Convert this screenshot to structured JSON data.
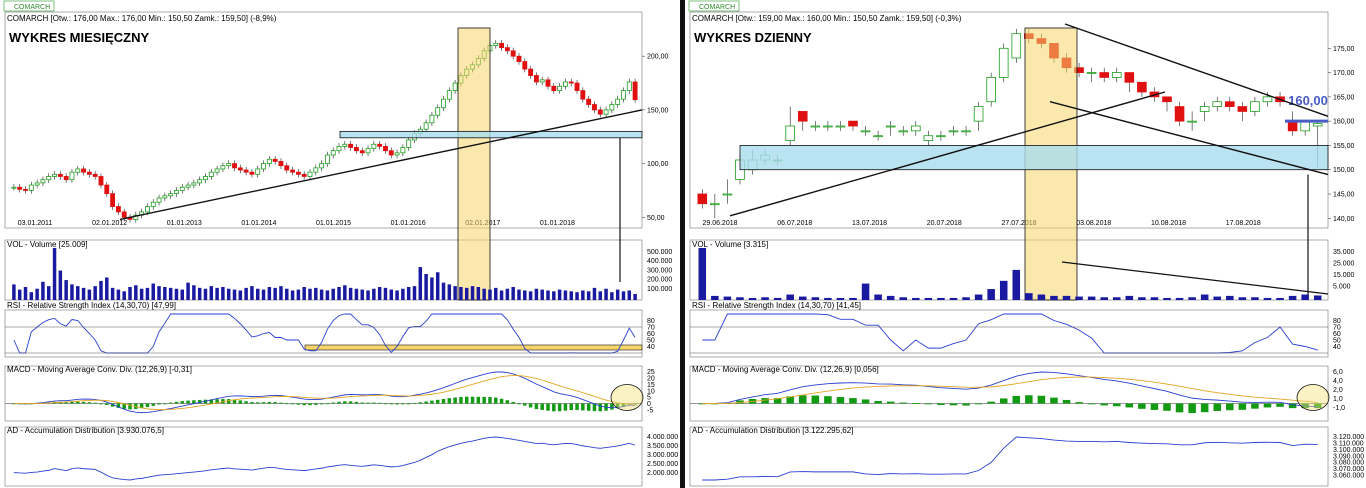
{
  "panels": [
    {
      "tab": "COMARCH",
      "info": "COMARCH [Otw.: 176,00  Max.: 176,00  Min.: 150,50  Zamk.: 159,50] (-8,9%)",
      "big_title": "WYKRES MIESIĘCZNY",
      "vol_title": "VOL - Volume [25.009]",
      "rsi_title": "RSI - Relative Strength Index (14,30,70) [47,99]",
      "macd_title": "MACD - Moving Average Conv. Div. (12,26,9) [-0,31]",
      "ad_title": "AD - Accumulation Distribution [3.930.076,5]",
      "price_labels": [
        "200,00",
        "150,00",
        "100,00",
        "50,00"
      ],
      "date_labels": [
        "03.01.2011",
        "02.01.2012",
        "01.01.2013",
        "01.01.2014",
        "01.01.2015",
        "01.01.2016",
        "02.01.2017",
        "01.01.2018"
      ],
      "vol_labels": [
        "500.000",
        "400.000",
        "300.000",
        "200.000",
        "100.000"
      ],
      "rsi_labels": [
        "80",
        "70",
        "60",
        "50",
        "40"
      ],
      "macd_labels": [
        "25",
        "20",
        "15",
        "10",
        "5",
        "0",
        "-5"
      ],
      "ad_labels": [
        "4.000.000",
        "3.500.000",
        "3.000.000",
        "2.500.000",
        "2.000.000"
      ]
    },
    {
      "tab": "COMARCH",
      "info": "COMARCH [Otw.: 159,00  Max.: 160,00  Min.: 150,50  Zamk.: 159,50] (-0,3%)",
      "big_title": "WYKRES DZIENNY",
      "price_tag": "160,00",
      "vol_title": "VOL - Volume [3.315]",
      "rsi_title": "RSI - Relative Strength Index (14,30,70) [41,45]",
      "macd_title": "MACD - Moving Average Conv. Div. (12,26,9) [0,056]",
      "ad_title": "AD - Accumulation Distribution [3.122.295,62]",
      "price_labels": [
        "175,00",
        "170,00",
        "165,00",
        "160,00",
        "155,00",
        "150,00",
        "145,00",
        "140,00"
      ],
      "date_labels": [
        "29.06.2018",
        "06.07.2018",
        "13.07.2018",
        "20.07.2018",
        "27.07.2018",
        "03.08.2018",
        "10.08.2018",
        "17.08.2018"
      ],
      "vol_labels": [
        "35.000",
        "25.000",
        "15.000",
        "5.000"
      ],
      "rsi_labels": [
        "80",
        "70",
        "60",
        "50",
        "40"
      ],
      "macd_labels": [
        "6,0",
        "4,0",
        "2,0",
        "1,0",
        "-1,0"
      ],
      "ad_labels": [
        "3.120.000",
        "3.110.000",
        "3.100.000",
        "3.090.000",
        "3.080.000",
        "3.070.000",
        "3.060.000"
      ]
    }
  ],
  "chart_data": [
    {
      "type": "candlestick",
      "title": "WYKRES MIESIĘCZNY",
      "frequency": "monthly",
      "x_start": "2010-09",
      "close": [
        78,
        76,
        75,
        80,
        82,
        85,
        88,
        90,
        88,
        85,
        92,
        95,
        92,
        90,
        88,
        80,
        72,
        60,
        55,
        50,
        48,
        52,
        55,
        60,
        64,
        68,
        70,
        72,
        75,
        78,
        80,
        82,
        85,
        88,
        92,
        95,
        98,
        100,
        96,
        94,
        92,
        90,
        95,
        100,
        104,
        102,
        98,
        94,
        92,
        90,
        88,
        92,
        96,
        100,
        108,
        112,
        116,
        118,
        115,
        112,
        110,
        114,
        118,
        116,
        112,
        108,
        110,
        115,
        122,
        128,
        132,
        138,
        145,
        152,
        160,
        168,
        175,
        182,
        188,
        192,
        198,
        205,
        210,
        212,
        208,
        205,
        200,
        195,
        188,
        182,
        176,
        178,
        172,
        168,
        172,
        176,
        175,
        168,
        160,
        155,
        150,
        146,
        150,
        155,
        160,
        168,
        176,
        159.5
      ],
      "vol_title": "VOL - Volume [25.009]",
      "volume": [
        180000,
        120000,
        150000,
        90000,
        130000,
        210000,
        160000,
        600000,
        340000,
        230000,
        180000,
        160000,
        140000,
        120000,
        160000,
        220000,
        260000,
        140000,
        120000,
        100000,
        150000,
        170000,
        130000,
        140000,
        190000,
        160000,
        150000,
        140000,
        130000,
        120000,
        200000,
        170000,
        140000,
        130000,
        160000,
        140000,
        150000,
        130000,
        120000,
        110000,
        140000,
        160000,
        130000,
        120000,
        150000,
        140000,
        160000,
        130000,
        110000,
        120000,
        150000,
        130000,
        140000,
        120000,
        110000,
        130000,
        150000,
        170000,
        140000,
        130000,
        120000,
        110000,
        130000,
        150000,
        140000,
        120000,
        110000,
        130000,
        150000,
        160000,
        380000,
        300000,
        260000,
        320000,
        200000,
        180000,
        160000,
        150000,
        140000,
        160000,
        150000,
        130000,
        120000,
        140000,
        110000,
        130000,
        150000,
        120000,
        110000,
        100000,
        130000,
        120000,
        110000,
        100000,
        120000,
        110000,
        100000,
        90000,
        110000,
        100000,
        140000,
        100000,
        130000,
        90000,
        120000,
        100000,
        110000,
        70000
      ],
      "rsi_period": "14,30,70",
      "rsi_last": 47.99,
      "macd_last": -0.31,
      "ad_last": 3930076.5
    },
    {
      "type": "candlestick",
      "title": "WYKRES DZIENNY",
      "frequency": "daily",
      "x_start": "2018-06-21",
      "open": [
        145,
        143,
        145,
        148,
        150,
        152,
        152,
        156,
        162,
        159,
        159,
        159,
        160,
        158,
        157,
        159,
        158,
        158,
        156,
        157,
        158,
        158,
        160,
        164,
        169,
        173,
        178,
        177,
        176,
        173,
        171,
        170,
        170,
        169,
        170,
        168,
        166,
        165,
        163,
        160,
        162,
        163,
        164,
        163,
        162,
        164,
        165,
        160,
        158,
        159
      ],
      "close": [
        143,
        143,
        145,
        152,
        152,
        153,
        152,
        159,
        160,
        159,
        159,
        159,
        159,
        158,
        157,
        159,
        158,
        159,
        157,
        157,
        158,
        158,
        163,
        169,
        175,
        178,
        177,
        176,
        173,
        171,
        170,
        170,
        169,
        170,
        168,
        166,
        165,
        164,
        160,
        160,
        163,
        164,
        163,
        162,
        164,
        165,
        164,
        158,
        160,
        159.5
      ],
      "high": [
        146,
        145,
        148,
        153,
        154,
        154,
        153,
        163,
        162,
        160,
        160,
        160,
        160,
        159,
        158,
        160,
        159,
        160,
        158,
        158,
        159,
        159,
        164,
        170,
        176,
        179,
        179,
        178,
        176,
        174,
        172,
        171,
        171,
        171,
        170,
        168,
        167,
        165,
        164,
        162,
        164,
        165,
        165,
        164,
        165,
        166,
        166,
        162,
        160,
        160
      ],
      "low": [
        142,
        140,
        143,
        147,
        149,
        151,
        151,
        155,
        158,
        158,
        158,
        158,
        158,
        157,
        156,
        157,
        157,
        157,
        155,
        156,
        157,
        157,
        158,
        163,
        168,
        172,
        176,
        175,
        172,
        170,
        169,
        168,
        168,
        168,
        166,
        165,
        164,
        162,
        159,
        158,
        160,
        162,
        162,
        160,
        161,
        163,
        163,
        157,
        157,
        150.5
      ],
      "volume_title": "VOL - Volume [3.315]",
      "volume": [
        38000,
        3000,
        2500,
        2000,
        1500,
        2000,
        1500,
        4000,
        2500,
        2000,
        1500,
        1500,
        1500,
        12000,
        4000,
        3000,
        2000,
        1500,
        1500,
        1500,
        1500,
        2000,
        4000,
        8000,
        14000,
        22000,
        5000,
        4000,
        3000,
        3000,
        2500,
        2500,
        2000,
        2000,
        3000,
        2000,
        2000,
        1500,
        1500,
        2000,
        4000,
        2500,
        3000,
        2000,
        2000,
        1500,
        1500,
        3000,
        4000,
        3315
      ],
      "rsi_period": "14,30,70",
      "rsi_last": 41.45,
      "macd_last": 0.056,
      "ad_last": 3122295.62,
      "levels": {
        "support_zone": [
          150,
          155
        ],
        "resistance": 160
      }
    }
  ]
}
